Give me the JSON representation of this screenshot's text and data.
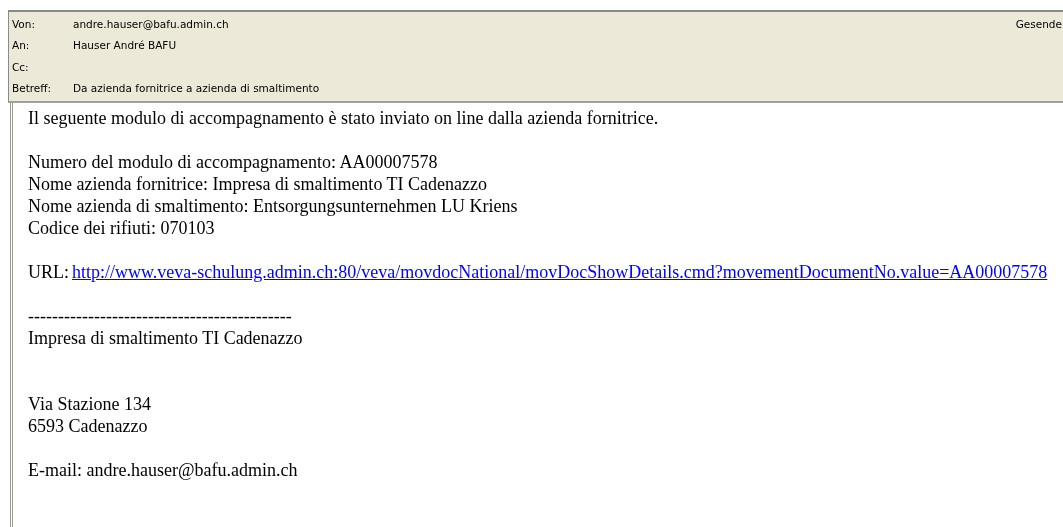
{
  "header": {
    "fields": [
      {
        "label": "Von:",
        "value": "andre.hauser@bafu.admin.ch"
      },
      {
        "label": "An:",
        "value": "Hauser André BAFU"
      },
      {
        "label": "Cc:"
      },
      {
        "label": "Betreff:",
        "value": "Da azienda fornitrice a azienda di smaltimento"
      }
    ],
    "sent_label": "Gesende"
  },
  "body": {
    "lines": [
      {
        "kind": "text",
        "text": "Il seguente modulo di accompagnamento è stato inviato on line dalla azienda fornitrice."
      },
      {
        "kind": "blank"
      },
      {
        "kind": "text",
        "text": "Numero del modulo di accompagnamento: AA00007578"
      },
      {
        "kind": "text",
        "text": "Nome azienda fornitrice: Impresa di smaltimento TI Cadenazzo"
      },
      {
        "kind": "text",
        "text": "Nome azienda di smaltimento: Entsorgungsunternehmen LU Kriens"
      },
      {
        "kind": "text",
        "text": "Codice dei rifiuti: 070103"
      },
      {
        "kind": "blank"
      },
      {
        "kind": "link",
        "text": "URL:",
        "link": "http://www.veva-schulung.admin.ch:80/veva/movdocNational/movDocShowDetails.cmd?movementDocumentNo.value=AA00007578"
      },
      {
        "kind": "blank"
      },
      {
        "kind": "text",
        "text": "--------------------------------------------"
      },
      {
        "kind": "text",
        "text": "Impresa di smaltimento TI Cadenazzo"
      },
      {
        "kind": "blank"
      },
      {
        "kind": "blank"
      },
      {
        "kind": "text",
        "text": "Via Stazione 134"
      },
      {
        "kind": "text",
        "text": "6593 Cadenazzo"
      },
      {
        "kind": "blank"
      },
      {
        "kind": "text",
        "text": "E-mail: andre.hauser@bafu.admin.ch"
      }
    ]
  }
}
